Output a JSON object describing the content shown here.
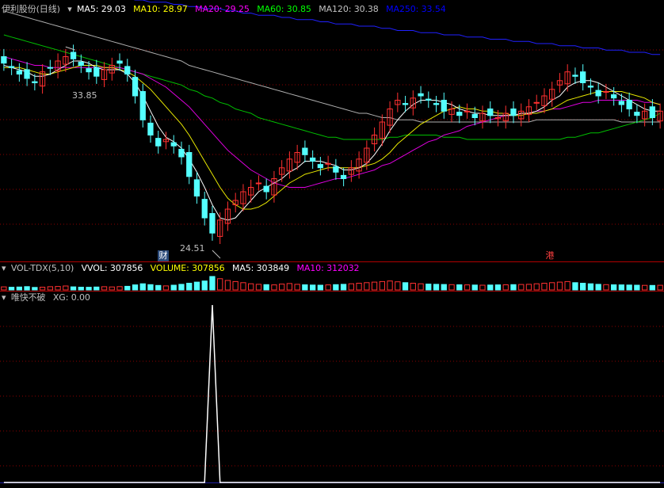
{
  "header": {
    "title": "伊利股份(日线)",
    "indicators": [
      {
        "label": "MA5: 29.03",
        "color": "#ffffff"
      },
      {
        "label": "MA10: 28.97",
        "color": "#ffff00"
      },
      {
        "label": "MA20: 29.25",
        "color": "#ff00ff"
      },
      {
        "label": "MA60: 30.85",
        "color": "#00ff00"
      },
      {
        "label": "MA120: 30.38",
        "color": "#c0c0c0"
      },
      {
        "label": "MA250: 33.54",
        "color": "#0000ff"
      }
    ]
  },
  "volume_header": {
    "title": "VOL-TDX(5,10)",
    "items": [
      {
        "label": "VVOL: 307856",
        "color": "#ffffff"
      },
      {
        "label": "VOLUME: 307856",
        "color": "#ffff00"
      },
      {
        "label": "MA5: 303849",
        "color": "#ffffff"
      },
      {
        "label": "MA10: 312032",
        "color": "#ff00ff"
      }
    ]
  },
  "signal_header": {
    "title": "唯快不破",
    "items": [
      {
        "label": "XG: 0.00",
        "color": "#c0c0c0"
      }
    ]
  },
  "markers": {
    "high_label": "33.85",
    "low_label": "24.51",
    "cai": "财",
    "gang": "港"
  },
  "colors": {
    "up": "#ff3030",
    "down": "#54ffff",
    "grid": "#8b0000",
    "bg": "#000000"
  },
  "chart_data": {
    "type": "candlestick",
    "ylim": [
      24.0,
      35.2
    ],
    "closes": [
      33.1,
      32.9,
      32.6,
      32.4,
      32.2,
      32.7,
      32.9,
      33.2,
      33.4,
      33.3,
      33.0,
      32.7,
      32.5,
      32.8,
      33.0,
      33.1,
      32.6,
      31.6,
      30.5,
      29.8,
      29.3,
      29.6,
      29.3,
      28.8,
      27.9,
      27.0,
      26.0,
      25.3,
      25.9,
      26.4,
      26.8,
      27.2,
      27.4,
      27.6,
      27.2,
      27.8,
      28.3,
      28.7,
      29.0,
      28.9,
      28.6,
      28.3,
      28.5,
      28.1,
      27.8,
      28.3,
      28.7,
      29.2,
      29.8,
      30.4,
      31.0,
      31.4,
      31.2,
      31.5,
      31.6,
      31.4,
      31.2,
      30.9,
      31.0,
      30.7,
      30.9,
      30.6,
      30.8,
      30.7,
      30.6,
      30.8,
      30.7,
      30.9,
      31.1,
      31.3,
      31.6,
      31.9,
      32.3,
      32.7,
      32.5,
      32.2,
      32.0,
      31.6,
      31.8,
      31.5,
      31.2,
      31.0,
      30.7,
      30.9,
      30.6,
      30.9
    ],
    "ma5": [
      33.0,
      32.9,
      32.8,
      32.7,
      32.5,
      32.5,
      32.6,
      32.8,
      33.0,
      33.2,
      33.2,
      33.1,
      32.9,
      32.8,
      32.8,
      32.8,
      32.6,
      32.2,
      31.6,
      30.9,
      30.2,
      29.7,
      29.5,
      29.2,
      28.7,
      28.1,
      27.4,
      26.6,
      26.0,
      25.9,
      26.0,
      26.4,
      26.8,
      27.2,
      27.4,
      27.6,
      27.8,
      28.1,
      28.3,
      28.6,
      28.6,
      28.6,
      28.5,
      28.4,
      28.2,
      28.2,
      28.3,
      28.5,
      28.9,
      29.4,
      30.0,
      30.5,
      30.9,
      31.2,
      31.4,
      31.4,
      31.4,
      31.3,
      31.2,
      31.0,
      30.9,
      30.8,
      30.8,
      30.7,
      30.7,
      30.7,
      30.7,
      30.8,
      30.8,
      30.9,
      31.1,
      31.4,
      31.6,
      32.0,
      32.2,
      32.3,
      32.3,
      32.2,
      32.0,
      31.8,
      31.6,
      31.4,
      31.2,
      31.0,
      30.9,
      30.9
    ],
    "ma10": [
      32.9,
      32.9,
      32.9,
      32.8,
      32.7,
      32.6,
      32.6,
      32.7,
      32.8,
      32.9,
      33.0,
      33.0,
      33.0,
      32.9,
      32.9,
      32.8,
      32.7,
      32.5,
      32.2,
      31.9,
      31.5,
      31.1,
      30.7,
      30.3,
      29.8,
      29.2,
      28.6,
      28.0,
      27.4,
      26.9,
      26.6,
      26.4,
      26.4,
      26.5,
      26.7,
      27.0,
      27.3,
      27.6,
      27.8,
      28.0,
      28.1,
      28.2,
      28.3,
      28.3,
      28.3,
      28.3,
      28.3,
      28.4,
      28.5,
      28.7,
      29.0,
      29.4,
      29.7,
      30.0,
      30.3,
      30.5,
      30.7,
      30.9,
      31.0,
      31.1,
      31.0,
      31.0,
      30.9,
      30.9,
      30.8,
      30.8,
      30.7,
      30.7,
      30.8,
      30.8,
      30.9,
      31.0,
      31.2,
      31.4,
      31.5,
      31.6,
      31.7,
      31.8,
      31.8,
      31.8,
      31.8,
      31.7,
      31.6,
      31.5,
      31.3,
      31.2
    ],
    "ma20": [
      33.4,
      33.3,
      33.2,
      33.1,
      33.0,
      33.0,
      32.9,
      32.9,
      32.9,
      32.9,
      32.9,
      32.9,
      32.9,
      32.9,
      32.9,
      32.9,
      32.8,
      32.7,
      32.6,
      32.4,
      32.2,
      32.0,
      31.7,
      31.4,
      31.1,
      30.7,
      30.3,
      29.9,
      29.5,
      29.1,
      28.8,
      28.5,
      28.2,
      28.0,
      27.8,
      27.6,
      27.5,
      27.4,
      27.4,
      27.4,
      27.5,
      27.6,
      27.7,
      27.8,
      27.8,
      27.9,
      28.0,
      28.1,
      28.2,
      28.4,
      28.5,
      28.7,
      28.9,
      29.1,
      29.3,
      29.5,
      29.6,
      29.8,
      29.9,
      30.0,
      30.2,
      30.3,
      30.4,
      30.5,
      30.6,
      30.7,
      30.7,
      30.8,
      30.8,
      30.9,
      30.9,
      31.0,
      31.0,
      31.1,
      31.2,
      31.3,
      31.3,
      31.4,
      31.4,
      31.4,
      31.4,
      31.4,
      31.4,
      31.3,
      31.3,
      31.2
    ],
    "ma60": [
      34.4,
      34.3,
      34.2,
      34.1,
      34.0,
      33.9,
      33.8,
      33.7,
      33.6,
      33.5,
      33.4,
      33.3,
      33.2,
      33.1,
      33.0,
      32.9,
      32.8,
      32.7,
      32.6,
      32.5,
      32.4,
      32.3,
      32.2,
      32.1,
      31.9,
      31.8,
      31.6,
      31.5,
      31.3,
      31.2,
      31.0,
      30.9,
      30.8,
      30.6,
      30.5,
      30.4,
      30.3,
      30.2,
      30.1,
      30.0,
      29.9,
      29.8,
      29.7,
      29.7,
      29.6,
      29.6,
      29.6,
      29.6,
      29.6,
      29.6,
      29.7,
      29.7,
      29.8,
      29.8,
      29.8,
      29.8,
      29.8,
      29.7,
      29.7,
      29.7,
      29.6,
      29.6,
      29.6,
      29.6,
      29.6,
      29.6,
      29.6,
      29.6,
      29.6,
      29.6,
      29.6,
      29.6,
      29.6,
      29.7,
      29.7,
      29.8,
      29.9,
      29.9,
      30.0,
      30.1,
      30.2,
      30.3,
      30.4,
      30.5,
      30.6,
      30.8
    ],
    "ma120": [
      35.5,
      35.4,
      35.3,
      35.2,
      35.1,
      35.0,
      34.9,
      34.8,
      34.7,
      34.6,
      34.5,
      34.4,
      34.3,
      34.2,
      34.1,
      34.0,
      33.9,
      33.8,
      33.7,
      33.6,
      33.5,
      33.4,
      33.3,
      33.2,
      33.0,
      32.9,
      32.8,
      32.7,
      32.6,
      32.5,
      32.4,
      32.3,
      32.2,
      32.1,
      32.0,
      31.9,
      31.8,
      31.7,
      31.6,
      31.5,
      31.4,
      31.3,
      31.2,
      31.1,
      31.0,
      30.9,
      30.8,
      30.8,
      30.7,
      30.6,
      30.6,
      30.5,
      30.5,
      30.5,
      30.4,
      30.4,
      30.4,
      30.4,
      30.4,
      30.4,
      30.4,
      30.4,
      30.4,
      30.4,
      30.4,
      30.4,
      30.4,
      30.4,
      30.4,
      30.5,
      30.5,
      30.5,
      30.5,
      30.5,
      30.5,
      30.5,
      30.5,
      30.5,
      30.5,
      30.5,
      30.4,
      30.4,
      30.4,
      30.4,
      30.4,
      30.4
    ],
    "ma250": [
      36.6,
      36.6,
      36.5,
      36.5,
      36.5,
      36.4,
      36.4,
      36.4,
      36.3,
      36.3,
      36.3,
      36.2,
      36.2,
      36.2,
      36.1,
      36.1,
      36.1,
      36.0,
      36.0,
      35.9,
      35.9,
      35.9,
      35.8,
      35.8,
      35.7,
      35.7,
      35.6,
      35.6,
      35.6,
      35.5,
      35.5,
      35.4,
      35.4,
      35.3,
      35.3,
      35.3,
      35.2,
      35.2,
      35.1,
      35.1,
      35.1,
      35.0,
      35.0,
      34.9,
      34.9,
      34.9,
      34.8,
      34.8,
      34.8,
      34.7,
      34.7,
      34.6,
      34.6,
      34.6,
      34.5,
      34.5,
      34.5,
      34.4,
      34.4,
      34.4,
      34.3,
      34.3,
      34.3,
      34.2,
      34.2,
      34.2,
      34.1,
      34.1,
      34.1,
      34.0,
      34.0,
      34.0,
      33.9,
      33.9,
      33.9,
      33.8,
      33.8,
      33.8,
      33.7,
      33.7,
      33.7,
      33.6,
      33.6,
      33.6,
      33.5,
      33.5
    ],
    "volume": [
      55,
      48,
      52,
      60,
      45,
      50,
      58,
      62,
      70,
      55,
      50,
      48,
      52,
      58,
      54,
      60,
      65,
      90,
      110,
      95,
      80,
      72,
      85,
      100,
      120,
      140,
      160,
      240,
      200,
      170,
      150,
      130,
      110,
      100,
      95,
      90,
      105,
      115,
      100,
      92,
      88,
      85,
      90,
      95,
      100,
      110,
      120,
      130,
      140,
      150,
      160,
      145,
      130,
      120,
      110,
      105,
      100,
      98,
      95,
      92,
      90,
      88,
      85,
      87,
      90,
      92,
      95,
      98,
      100,
      110,
      120,
      130,
      140,
      150,
      130,
      120,
      110,
      100,
      95,
      92,
      90,
      88,
      85,
      82,
      80,
      84
    ],
    "signal": [
      0,
      0,
      0,
      0,
      0,
      0,
      0,
      0,
      0,
      0,
      0,
      0,
      0,
      0,
      0,
      0,
      0,
      0,
      0,
      0,
      0,
      0,
      0,
      0,
      0,
      0,
      0,
      1,
      0,
      0,
      0,
      0,
      0,
      0,
      0,
      0,
      0,
      0,
      0,
      0,
      0,
      0,
      0,
      0,
      0,
      0,
      0,
      0,
      0,
      0,
      0,
      0,
      0,
      0,
      0,
      0,
      0,
      0,
      0,
      0,
      0,
      0,
      0,
      0,
      0,
      0,
      0,
      0,
      0,
      0,
      0,
      0,
      0,
      0,
      0,
      0,
      0,
      0,
      0,
      0,
      0,
      0,
      0,
      0,
      0,
      0
    ],
    "high_index": 8,
    "high_value": 33.85,
    "low_index": 27,
    "low_value": 24.51
  }
}
